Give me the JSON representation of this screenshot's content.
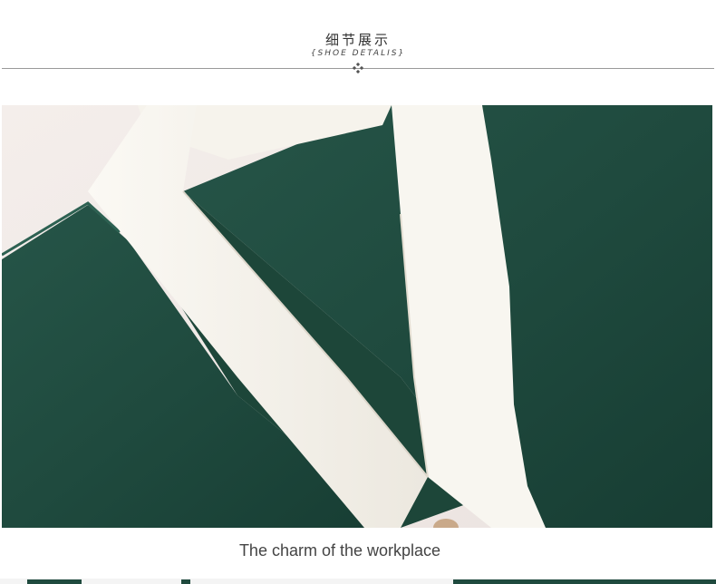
{
  "header": {
    "title_cn": "细节展示",
    "title_en": "{SHOE DETALIS}",
    "ornament_icon": "diamond-cluster-icon"
  },
  "photo": {
    "subject": "",
    "colors": {
      "fabric": "#1f4a3e",
      "collar": "#f6f3ec",
      "background": "#f2ecea",
      "button": "#c9a98a"
    }
  },
  "caption": {
    "text": "The charm of the workplace"
  }
}
